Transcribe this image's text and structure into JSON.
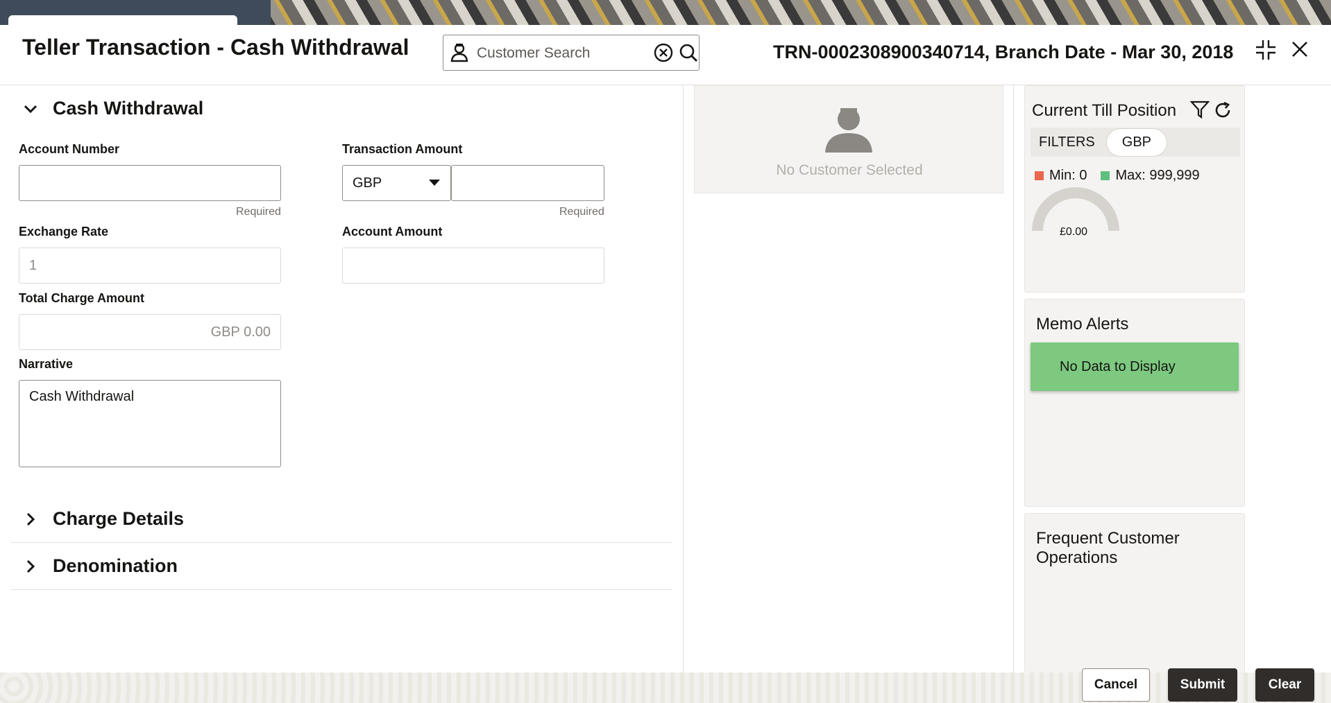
{
  "header": {
    "title": "Teller Transaction - Cash Withdrawal",
    "search_placeholder": "Customer Search",
    "transaction_info": "TRN-0002308900340714, Branch Date - Mar 30, 2018"
  },
  "cash_withdrawal": {
    "section_title": "Cash Withdrawal",
    "account_number_label": "Account Number",
    "account_number_value": "",
    "required_text": "Required",
    "transaction_amount_label": "Transaction Amount",
    "currency_selected": "GBP",
    "transaction_amount_value": "",
    "exchange_rate_label": "Exchange Rate",
    "exchange_rate_value": "1",
    "account_amount_label": "Account Amount",
    "account_amount_value": "",
    "total_charge_label": "Total Charge Amount",
    "total_charge_value": "GBP 0.00",
    "narrative_label": "Narrative",
    "narrative_value": "Cash Withdrawal"
  },
  "sections": {
    "charge_details": "Charge Details",
    "denomination": "Denomination"
  },
  "customer_panel": {
    "empty_text": "No Customer Selected"
  },
  "till_position": {
    "title": "Current Till Position",
    "filters_label": "FILTERS",
    "currency_pill": "GBP",
    "min_label": "Min: 0",
    "max_label": "Max: 999,999",
    "gauge_value": "£0.00",
    "gauge_fraction": 0,
    "min_color": "#e8674e",
    "max_color": "#5fbf7c"
  },
  "memo_alerts": {
    "title": "Memo Alerts",
    "empty_text": "No Data to Display"
  },
  "frequent_ops": {
    "title_line1": "Frequent Customer",
    "title_line2": "Operations"
  },
  "footer": {
    "cancel_label": "Cancel",
    "submit_label": "Submit",
    "clear_label": "Clear"
  }
}
